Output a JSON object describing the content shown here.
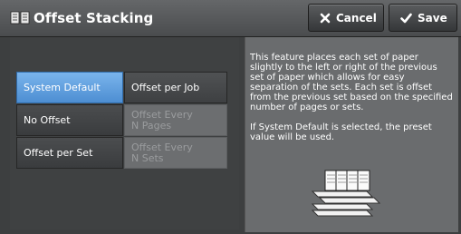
{
  "header": {
    "title": "Offset Stacking",
    "cancel_label": "Cancel",
    "save_label": "Save"
  },
  "options": {
    "rows": [
      {
        "main": "System Default",
        "sub": "Offset per Job"
      },
      {
        "main": "No Offset",
        "sub": "Offset Every\nN Pages"
      },
      {
        "main": "Offset per Set",
        "sub": "Offset Every\nN Sets"
      }
    ]
  },
  "description": {
    "para1": "This feature places each set of paper slightly to the left or right of the previous set of paper which allows for easy separation of the sets.  Each set is offset from the previous set based on the specified number of pages or sets.",
    "para2": "If System Default is selected, the preset value will be used."
  },
  "colors": {
    "selected": "#5c9ce0",
    "header": "#55575a",
    "panel": "#6a6c6e"
  },
  "icons": {
    "title": "offset-stack-icon",
    "cancel": "x-icon",
    "save": "checkmark-icon",
    "illustration": "offset-paper-stack-illustration"
  }
}
